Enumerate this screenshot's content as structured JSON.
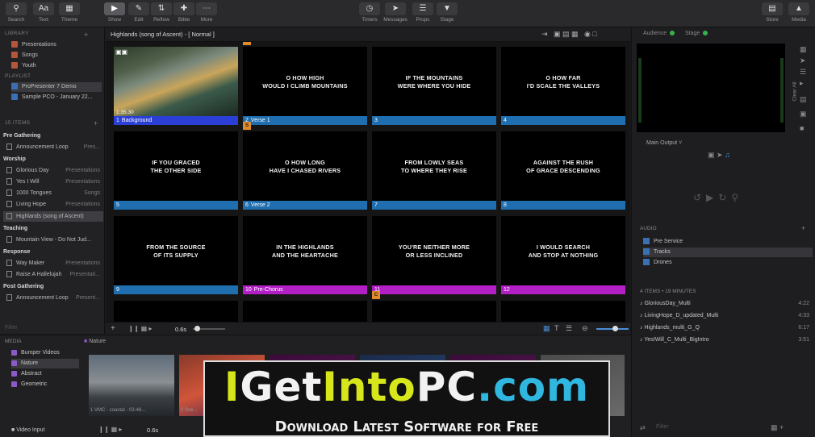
{
  "toolbar": {
    "left_buttons": [
      {
        "label": "Search",
        "icon": "search-icon"
      },
      {
        "label": "Text",
        "icon": "Aa"
      },
      {
        "label": "Theme",
        "icon": "theme-icon"
      }
    ],
    "mode_buttons": [
      {
        "label": "Show",
        "icon": "play-icon",
        "active": true
      },
      {
        "label": "Edit",
        "icon": "pencil-icon"
      },
      {
        "label": "Reflow",
        "icon": "reflow-icon"
      },
      {
        "label": "Bible",
        "icon": "bible-icon"
      },
      {
        "label": "More",
        "icon": "more-icon"
      }
    ],
    "center_buttons": [
      {
        "label": "Timers",
        "icon": "timer-icon"
      },
      {
        "label": "Messages",
        "icon": "messages-icon"
      },
      {
        "label": "Props",
        "icon": "props-icon"
      },
      {
        "label": "Stage",
        "icon": "stage-icon"
      }
    ],
    "right_buttons": [
      {
        "label": "Store",
        "icon": "cart-icon"
      },
      {
        "label": "Media",
        "icon": "media-icon"
      }
    ]
  },
  "library": {
    "header": "LIBRARY",
    "items": [
      "Presentations",
      "Songs",
      "Youth"
    ]
  },
  "playlist": {
    "header": "PLAYLIST",
    "items": [
      "ProPresenter 7 Demo",
      "Sample PCO - January 22..."
    ]
  },
  "items_panel": {
    "count": "15 ITEMS",
    "groups": [
      {
        "name": "Pre Gathering",
        "rows": [
          {
            "title": "Announcement Loop",
            "cat": "Pres..."
          }
        ]
      },
      {
        "name": "Worship",
        "rows": [
          {
            "title": "Glorious Day",
            "cat": "Presentations"
          },
          {
            "title": "Yes I Will",
            "cat": "Presentations"
          },
          {
            "title": "1000 Tongues",
            "cat": "Songs"
          },
          {
            "title": "Living Hope",
            "cat": "Presentations"
          },
          {
            "title": "Highlands (song of Ascent)",
            "cat": ""
          }
        ]
      },
      {
        "name": "Teaching",
        "rows": [
          {
            "title": "Mountain View - Do Not Jud...",
            "cat": ""
          }
        ]
      },
      {
        "name": "Response",
        "rows": [
          {
            "title": "Way Maker",
            "cat": "Presentations"
          },
          {
            "title": "Raise A Hallelujah",
            "cat": "Presentati..."
          }
        ]
      },
      {
        "name": "Post Gathering",
        "rows": [
          {
            "title": "Announcement Loop",
            "cat": "Present..."
          }
        ]
      }
    ],
    "filter_placeholder": "Filter"
  },
  "presentation": {
    "title": "Highlands (song of Ascent) - [ Normal ]",
    "background_time": "1:35.30",
    "slides": [
      {
        "num": "1",
        "label": "Background",
        "text": "",
        "color": "#2b3fd6",
        "badge": "",
        "image": true
      },
      {
        "num": "2",
        "label": "Verse 1",
        "text": "O HOW HIGH\nWOULD I CLIMB MOUNTAINS",
        "color": "#1f6fb0",
        "badge": "A"
      },
      {
        "num": "3",
        "label": "",
        "text": "IF THE MOUNTAINS\nWERE WHERE YOU HIDE",
        "color": "#1f6fb0",
        "badge": ""
      },
      {
        "num": "4",
        "label": "",
        "text": "O HOW FAR\nI'D SCALE THE VALLEYS",
        "color": "#1f6fb0",
        "badge": ""
      },
      {
        "num": "5",
        "label": "",
        "text": "IF YOU GRACED\nTHE OTHER SIDE",
        "color": "#1f6fb0",
        "badge": ""
      },
      {
        "num": "6",
        "label": "Verse 2",
        "text": "O HOW LONG\nHAVE I CHASED RIVERS",
        "color": "#1f6fb0",
        "badge": "S"
      },
      {
        "num": "7",
        "label": "",
        "text": "FROM LOWLY SEAS\nTO WHERE THEY RISE",
        "color": "#1f6fb0",
        "badge": ""
      },
      {
        "num": "8",
        "label": "",
        "text": "AGAINST THE RUSH\nOF GRACE DESCENDING",
        "color": "#1f6fb0",
        "badge": ""
      },
      {
        "num": "9",
        "label": "",
        "text": "FROM THE SOURCE\nOF ITS SUPPLY",
        "color": "#1f6fb0",
        "badge": ""
      },
      {
        "num": "10",
        "label": "Pre-Chorus",
        "text": "IN THE HIGHLANDS\nAND THE HEARTACHE",
        "color": "#b21fc4",
        "badge": ""
      },
      {
        "num": "11",
        "label": "",
        "text": "YOU'RE NEITHER MORE\nOR LESS INCLINED",
        "color": "#b21fc4",
        "badge": ""
      },
      {
        "num": "12",
        "label": "",
        "text": "I WOULD SEARCH\nAND STOP AT NOTHING",
        "color": "#b21fc4",
        "badge": ""
      },
      {
        "num": "",
        "label": "",
        "text": "",
        "color": "",
        "badge": ""
      },
      {
        "num": "",
        "label": "",
        "text": "",
        "color": "",
        "badge": ""
      },
      {
        "num": "",
        "label": "",
        "text": "",
        "color": "",
        "badge": "C"
      },
      {
        "num": "",
        "label": "",
        "text": "",
        "color": "",
        "badge": ""
      }
    ],
    "footer_time": "0.6s"
  },
  "right": {
    "audience": "Audience",
    "stage": "Stage",
    "clear_all": "Clear All",
    "main_output": "Main Output",
    "audio_header": "AUDIO",
    "audio_items": [
      "Pre Service",
      "Tracks",
      "Drones"
    ],
    "tracks_header": "4 ITEMS • 19 MINUTES",
    "tracks": [
      {
        "name": "GloriousDay_Multi",
        "dur": "4:22"
      },
      {
        "name": "LivingHope_D_updated_Multi",
        "dur": "4:33"
      },
      {
        "name": "Highlands_multi_G_Q",
        "dur": "6:17"
      },
      {
        "name": "YesIWill_C_Multi_BigIntro",
        "dur": "3:51"
      }
    ],
    "filter_placeholder": "Filter"
  },
  "media": {
    "header": "MEDIA",
    "items": [
      "Bumper Videos",
      "Nature",
      "Abstract",
      "Geometric"
    ],
    "folder": "Nature",
    "video_input": "Video Input",
    "thumb_caption": "1 VMC - coastal - 03-46...",
    "thumb_caption2": "2 Sce...",
    "footer_time": "0.6s"
  },
  "watermark": {
    "title_i": "I",
    "title_get": "Get",
    "title_into": "Into",
    "title_pc": "PC",
    "title_com": ".com",
    "subtitle": "Download Latest Software for Free"
  },
  "colors": {
    "accent_blue": "#1f6fb0",
    "accent_purple": "#b21fc4",
    "status_green": "#35b34a"
  }
}
